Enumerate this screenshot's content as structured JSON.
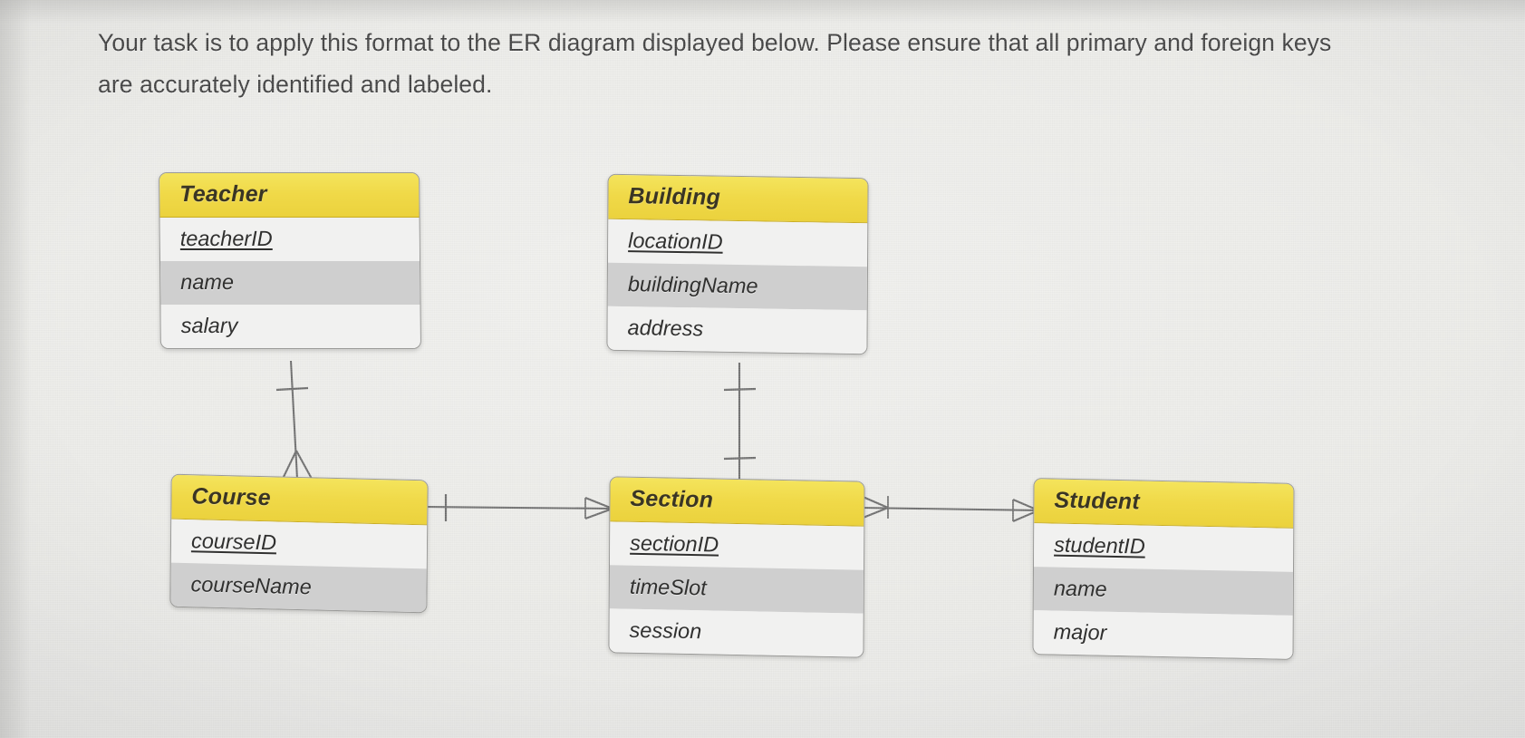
{
  "instructions": {
    "text": "Your task is to apply this format to the ER diagram displayed below. Please ensure that all primary and foreign keys are accurately identified and labeled."
  },
  "theme": {
    "header_fill": "#f0d948",
    "header_border": "#c9ad22",
    "row_light": "#f1f1f0",
    "row_dark": "#cfcfcf",
    "box_border": "#9a9a98",
    "line_color": "#6b6b6b",
    "page_background": "#e9e9e6",
    "text_color": "#30302f"
  },
  "diagram": {
    "type": "er-diagram",
    "notation": "crows-foot",
    "entities": [
      {
        "id": "teacher",
        "name": "Teacher",
        "attributes": [
          {
            "name": "teacherID",
            "key": "PK"
          },
          {
            "name": "name",
            "key": ""
          },
          {
            "name": "salary",
            "key": ""
          }
        ]
      },
      {
        "id": "building",
        "name": "Building",
        "attributes": [
          {
            "name": "locationID",
            "key": "PK"
          },
          {
            "name": "buildingName",
            "key": ""
          },
          {
            "name": "address",
            "key": ""
          }
        ]
      },
      {
        "id": "course",
        "name": "Course",
        "attributes": [
          {
            "name": "courseID",
            "key": "PK"
          },
          {
            "name": "courseName",
            "key": ""
          }
        ]
      },
      {
        "id": "section",
        "name": "Section",
        "attributes": [
          {
            "name": "sectionID",
            "key": "PK"
          },
          {
            "name": "timeSlot",
            "key": ""
          },
          {
            "name": "session",
            "key": ""
          }
        ]
      },
      {
        "id": "student",
        "name": "Student",
        "attributes": [
          {
            "name": "studentID",
            "key": "PK"
          },
          {
            "name": "name",
            "key": ""
          },
          {
            "name": "major",
            "key": ""
          }
        ]
      }
    ],
    "relationships": [
      {
        "id": "teacher-course",
        "from": "Teacher",
        "to": "Course",
        "from_cardinality": "one",
        "to_cardinality": "many"
      },
      {
        "id": "building-section",
        "from": "Building",
        "to": "Section",
        "from_cardinality": "one",
        "to_cardinality": "one"
      },
      {
        "id": "course-section",
        "from": "Course",
        "to": "Section",
        "from_cardinality": "one",
        "to_cardinality": "many"
      },
      {
        "id": "section-student",
        "from": "Section",
        "to": "Student",
        "from_cardinality": "many",
        "to_cardinality": "many"
      }
    ]
  }
}
